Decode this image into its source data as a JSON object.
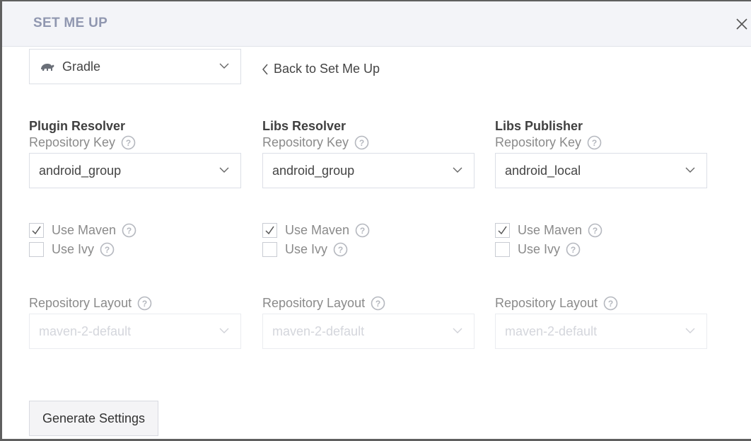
{
  "modal": {
    "title": "SET ME UP",
    "close_icon": "close-icon"
  },
  "tool_select": {
    "value": "Gradle",
    "icon": "gradle-elephant-icon"
  },
  "back_link": {
    "label": "Back to Set Me Up",
    "icon": "chevron-left-icon"
  },
  "columns": [
    {
      "title": "Plugin Resolver",
      "repo_key_label": "Repository Key",
      "repo_key_value": "android_group",
      "use_maven_label": "Use Maven",
      "use_maven_checked": true,
      "use_ivy_label": "Use Ivy",
      "use_ivy_checked": false,
      "layout_label": "Repository Layout",
      "layout_value": "maven-2-default"
    },
    {
      "title": "Libs Resolver",
      "repo_key_label": "Repository Key",
      "repo_key_value": "android_group",
      "use_maven_label": "Use Maven",
      "use_maven_checked": true,
      "use_ivy_label": "Use Ivy",
      "use_ivy_checked": false,
      "layout_label": "Repository Layout",
      "layout_value": "maven-2-default"
    },
    {
      "title": "Libs Publisher",
      "repo_key_label": "Repository Key",
      "repo_key_value": "android_local",
      "use_maven_label": "Use Maven",
      "use_maven_checked": true,
      "use_ivy_label": "Use Ivy",
      "use_ivy_checked": false,
      "layout_label": "Repository Layout",
      "layout_value": "maven-2-default"
    }
  ],
  "generate_button": {
    "label": "Generate Settings"
  },
  "colors": {
    "header_bg": "#f3f4f8",
    "title": "#9097b0",
    "border": "#dcdfe6",
    "disabled_text": "#d4d6dc"
  }
}
